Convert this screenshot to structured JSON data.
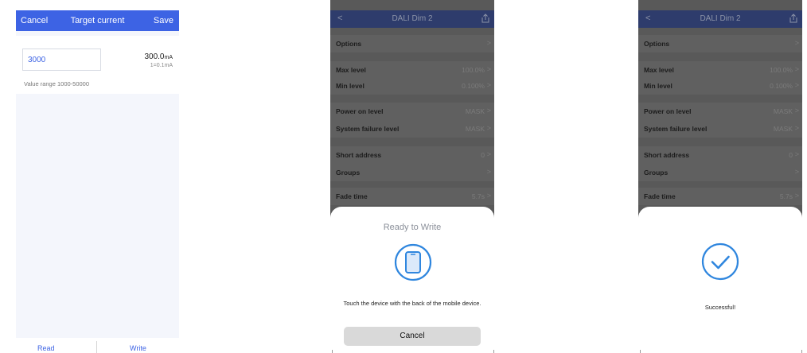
{
  "screen1": {
    "header": {
      "cancel": "Cancel",
      "title": "Target current",
      "save": "Save"
    },
    "input": {
      "value": "3000"
    },
    "current": {
      "value": "300.0",
      "unit": "mA",
      "conversion": "1=0.1mA"
    },
    "range": "Value range 1000-50000",
    "footer": {
      "read": "Read",
      "write": "Write"
    }
  },
  "dim": {
    "back": "<",
    "title": "DALI Dim 2",
    "rows": [
      {
        "label": "Options",
        "value": ""
      },
      {
        "label": "Max level",
        "value": "100.0%"
      },
      {
        "label": "Min level",
        "value": "0.100%"
      },
      {
        "label": "Power on level",
        "value": "MASK"
      },
      {
        "label": "System failure level",
        "value": "MASK"
      },
      {
        "label": "Short address",
        "value": "0"
      },
      {
        "label": "Groups",
        "value": ""
      },
      {
        "label": "Fade time",
        "value": "5.7s"
      }
    ],
    "chevron": ">"
  },
  "screen2": {
    "sheet_title": "Ready to Write",
    "message": "Touch the device with the back of the mobile device.",
    "cancel": "Cancel"
  },
  "screen3": {
    "message": "Successful!"
  },
  "colors": {
    "accent": "#3d63e4",
    "sheet_icon": "#2f86de",
    "dim_header": "#2e3c6c"
  }
}
